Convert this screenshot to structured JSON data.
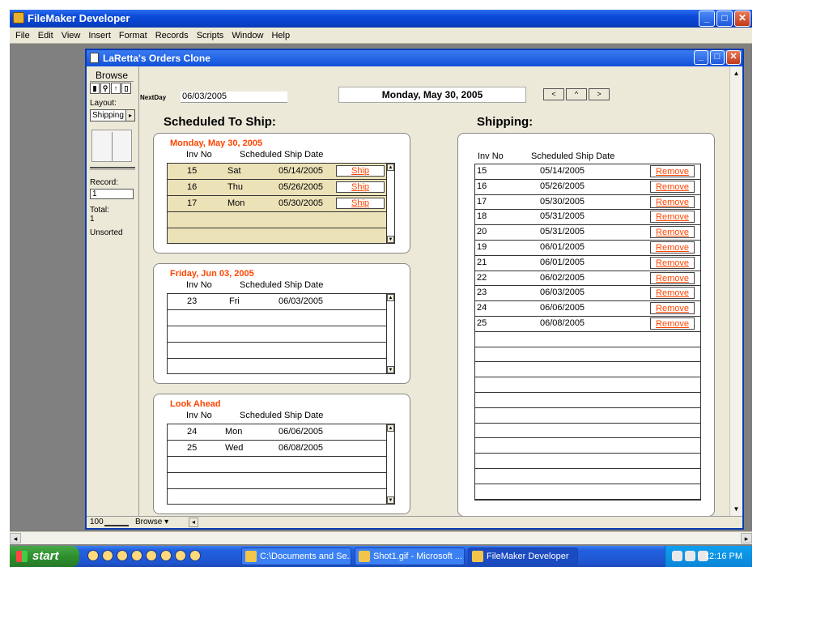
{
  "app": {
    "title": "FileMaker Developer"
  },
  "menu": [
    "File",
    "Edit",
    "View",
    "Insert",
    "Format",
    "Records",
    "Scripts",
    "Window",
    "Help"
  ],
  "child": {
    "title": "LaRetta's Orders Clone"
  },
  "status_area": {
    "mode": "Browse",
    "layout_label": "Layout:",
    "layout_value": "Shipping",
    "record_label": "Record:",
    "record_value": "1",
    "total_label": "Total:",
    "total_value": "1",
    "sort": "Unsorted"
  },
  "bottom": {
    "zoom": "100",
    "mode": "Browse"
  },
  "header": {
    "nextday_label": "NextDay",
    "nextday_value": "06/03/2005",
    "date_title": "Monday, May 30, 2005",
    "nav": [
      "<",
      "^",
      ">"
    ]
  },
  "scheduled": {
    "heading": "Scheduled To Ship:",
    "col_inv": "Inv No",
    "col_date": "Scheduled Ship Date",
    "ship_label": "Ship",
    "today": {
      "title": "Monday, May 30, 2005",
      "rows": [
        {
          "inv": "15",
          "day": "Sat",
          "date": "05/14/2005"
        },
        {
          "inv": "16",
          "day": "Thu",
          "date": "05/26/2005"
        },
        {
          "inv": "17",
          "day": "Mon",
          "date": "05/30/2005"
        }
      ]
    },
    "nextday": {
      "title": "Friday, Jun 03, 2005",
      "rows": [
        {
          "inv": "23",
          "day": "Fri",
          "date": "06/03/2005"
        }
      ]
    },
    "lookahead": {
      "title": "Look Ahead",
      "rows": [
        {
          "inv": "24",
          "day": "Mon",
          "date": "06/06/2005"
        },
        {
          "inv": "25",
          "day": "Wed",
          "date": "06/08/2005"
        }
      ]
    }
  },
  "shipping": {
    "heading": "Shipping:",
    "col_inv": "Inv No",
    "col_date": "Scheduled Ship Date",
    "remove_label": "Remove",
    "rows": [
      {
        "inv": "15",
        "date": "05/14/2005"
      },
      {
        "inv": "16",
        "date": "05/26/2005"
      },
      {
        "inv": "17",
        "date": "05/30/2005"
      },
      {
        "inv": "18",
        "date": "05/31/2005"
      },
      {
        "inv": "20",
        "date": "05/31/2005"
      },
      {
        "inv": "19",
        "date": "06/01/2005"
      },
      {
        "inv": "21",
        "date": "06/01/2005"
      },
      {
        "inv": "22",
        "date": "06/02/2005"
      },
      {
        "inv": "23",
        "date": "06/03/2005"
      },
      {
        "inv": "24",
        "date": "06/06/2005"
      },
      {
        "inv": "25",
        "date": "06/08/2005"
      }
    ]
  },
  "taskbar": {
    "start": "start",
    "tasks": [
      "C:\\Documents and Se...",
      "Shot1.gif - Microsoft ...",
      "FileMaker Developer"
    ],
    "clock": "12:16 PM"
  },
  "colors": {
    "accent": "#ff4500",
    "portal_tan": "#ece2b8",
    "titlebar": "#0b49d6"
  }
}
